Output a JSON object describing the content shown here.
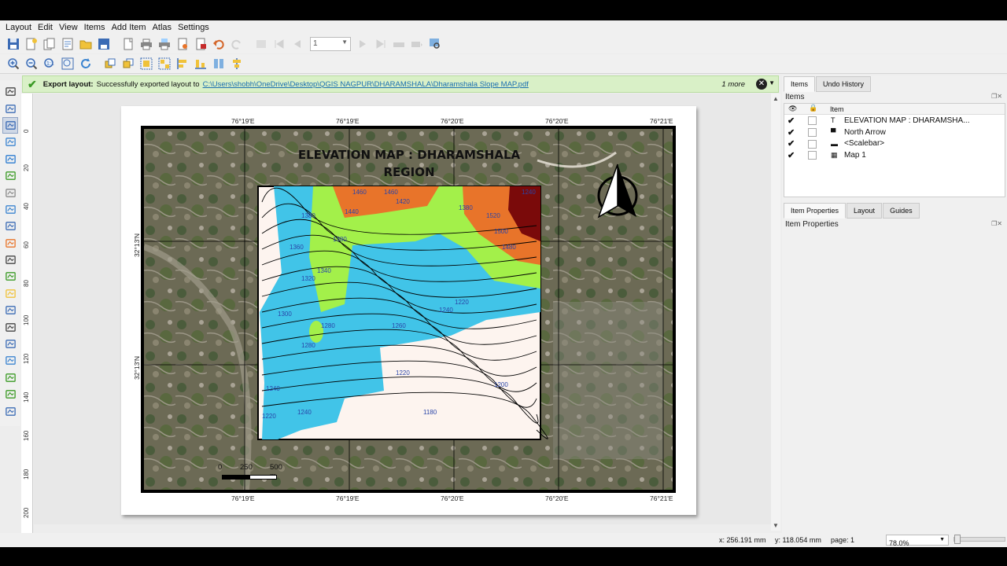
{
  "menu": [
    "Layout",
    "Edit",
    "View",
    "Items",
    "Add Item",
    "Atlas",
    "Settings"
  ],
  "toolbar1": {
    "icons": [
      "save-icon",
      "new-layout-icon",
      "duplicate-layout-icon",
      "layout-manager-icon",
      "open-template-icon",
      "save-template-icon",
      "page-setup-icon",
      "print-icon",
      "export-image-icon",
      "export-svg-icon",
      "export-pdf-icon",
      "undo-icon",
      "redo-icon"
    ],
    "atlas_icons": [
      "atlas-settings-icon",
      "first-feature-icon",
      "previous-feature-icon"
    ],
    "page_value": "1",
    "atlas_icons2": [
      "next-feature-icon",
      "last-feature-icon",
      "atlas-print-icon",
      "atlas-export-icon",
      "atlas-zoom-icon"
    ]
  },
  "toolbar2": {
    "icons": [
      "zoom-in-icon",
      "zoom-out-icon",
      "zoom-actual-icon",
      "zoom-full-icon",
      "refresh-icon",
      "raise-items-icon",
      "lower-items-icon",
      "group-items-icon",
      "ungroup-items-icon",
      "align-left-icon",
      "align-distribute-icon",
      "resize-icon",
      "align-center-icon"
    ]
  },
  "message": {
    "title": "Export layout:",
    "text": "Successfully exported layout to",
    "link": "C:\\Users\\shobh\\OneDrive\\Desktop\\QGIS NAGPUR\\DHARAMSHALA\\Dharamshala Slope MAP.pdf",
    "more": "1 more"
  },
  "left_tools": [
    "pan-icon",
    "zoom-tool-icon",
    "select-move-icon",
    "move-content-icon",
    "edit-nodes-icon",
    "add-map-icon",
    "add-3d-map-icon",
    "add-picture-icon",
    "add-label-icon",
    "add-legend-icon",
    "add-scalebar-icon",
    "add-north-arrow-icon",
    "add-shape-icon",
    "add-marker-icon",
    "add-arrow-icon",
    "add-polyline-icon",
    "add-html-icon",
    "add-attribute-table-icon",
    "add-fixed-table-icon",
    "add-elevation-profile-icon"
  ],
  "ruler": [
    "0",
    "20",
    "40",
    "60",
    "80",
    "100",
    "120",
    "140",
    "160",
    "180",
    "200"
  ],
  "map": {
    "title_line1": "ELEVATION MAP : DHARAMSHALA",
    "title_line2": "REGION",
    "top_coords": [
      "76°19'E",
      "76°19'E",
      "76°20'E",
      "76°20'E",
      "76°21'E"
    ],
    "bottom_coords": [
      "76°19'E",
      "76°19'E",
      "76°20'E",
      "76°20'E",
      "76°21'E"
    ],
    "left_coords": [
      "32°13'N",
      "32°13'N"
    ],
    "contours": [
      "1460",
      "1460",
      "1420",
      "1440",
      "1380",
      "1380",
      "1360",
      "1340",
      "1320",
      "1300",
      "1280",
      "1260",
      "1240",
      "1240",
      "1240",
      "1220",
      "1200",
      "1180",
      "1280",
      "1240",
      "1220",
      "1220",
      "1520",
      "1500",
      "1480",
      "1380"
    ],
    "scalebar_labels": [
      "0",
      "250",
      "500 m"
    ]
  },
  "panel": {
    "tabs": [
      "Items",
      "Undo History"
    ],
    "items_title": "Items",
    "header_item": "Item",
    "items": [
      {
        "name": "ELEVATION MAP : DHARAMSHA...",
        "icon": "label-icon"
      },
      {
        "name": "North Arrow",
        "icon": "picture-icon"
      },
      {
        "name": "<Scalebar>",
        "icon": "scalebar-icon"
      },
      {
        "name": "Map 1",
        "icon": "map-icon"
      }
    ],
    "prop_tabs": [
      "Item Properties",
      "Layout",
      "Guides"
    ],
    "prop_title": "Item Properties"
  },
  "status": {
    "x": "x: 256.191 mm",
    "y": "y: 118.054 mm",
    "page": "page: 1",
    "zoom": "78.0%"
  },
  "colors": {
    "message_bg": "#d9f0c7",
    "contour_cyan": "#41c4e8",
    "contour_green": "#a3f04a",
    "contour_orange": "#e8742a",
    "contour_darkred": "#7a0a0a",
    "contour_white": "#fdf4ef"
  }
}
